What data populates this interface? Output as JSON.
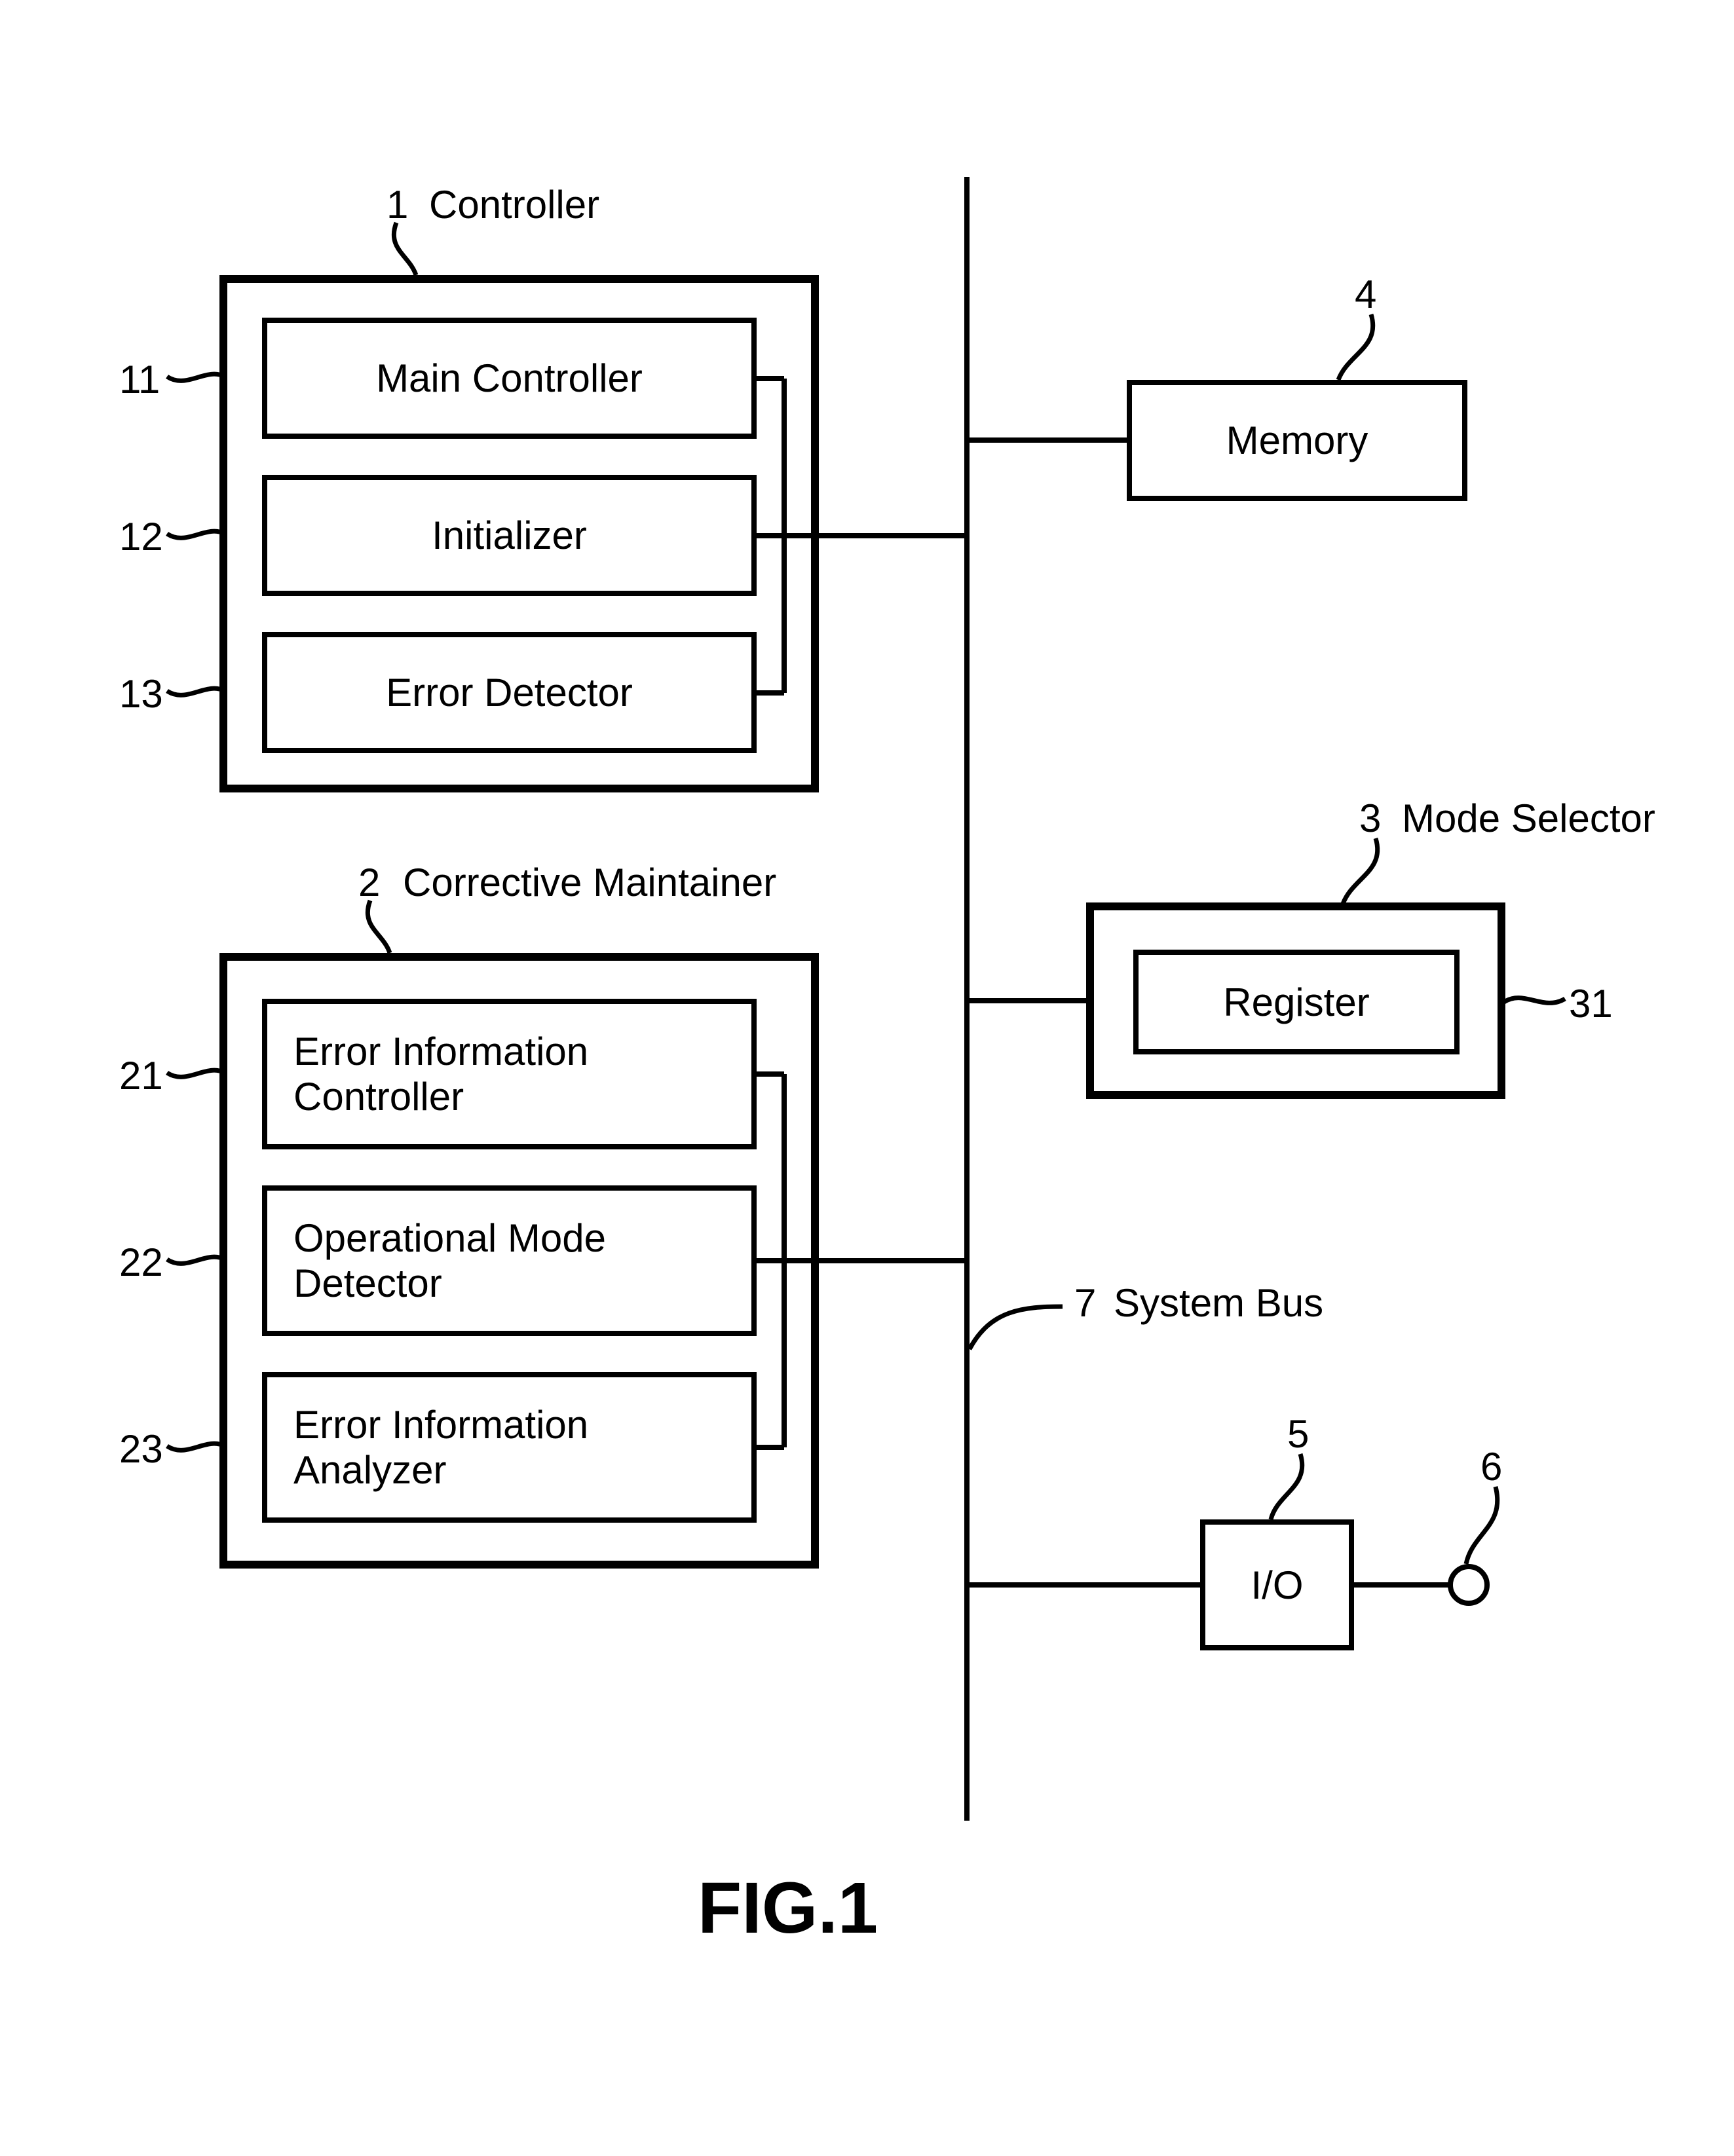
{
  "figure_title": "FIG.1",
  "blocks": {
    "controller": {
      "ref_num": "1",
      "name": "Controller",
      "children": {
        "main_controller": {
          "ref_num": "11",
          "label": "Main Controller"
        },
        "initializer": {
          "ref_num": "12",
          "label": "Initializer"
        },
        "error_detector": {
          "ref_num": "13",
          "label": "Error Detector"
        }
      }
    },
    "corrective_maintainer": {
      "ref_num": "2",
      "name": "Corrective Maintainer",
      "children": {
        "error_info_controller": {
          "ref_num": "21",
          "label": "Error Information\nController"
        },
        "op_mode_detector": {
          "ref_num": "22",
          "label": "Operational Mode\nDetector"
        },
        "error_info_analyzer": {
          "ref_num": "23",
          "label": "Error Information\nAnalyzer"
        }
      }
    },
    "memory": {
      "ref_num": "4",
      "label": "Memory"
    },
    "mode_selector": {
      "ref_num": "3",
      "name": "Mode Selector",
      "children": {
        "register": {
          "ref_num": "31",
          "label": "Register"
        }
      }
    },
    "io": {
      "ref_num": "5",
      "label": "I/O"
    },
    "io_port": {
      "ref_num": "6"
    },
    "system_bus": {
      "ref_num": "7",
      "label": "System Bus"
    }
  }
}
